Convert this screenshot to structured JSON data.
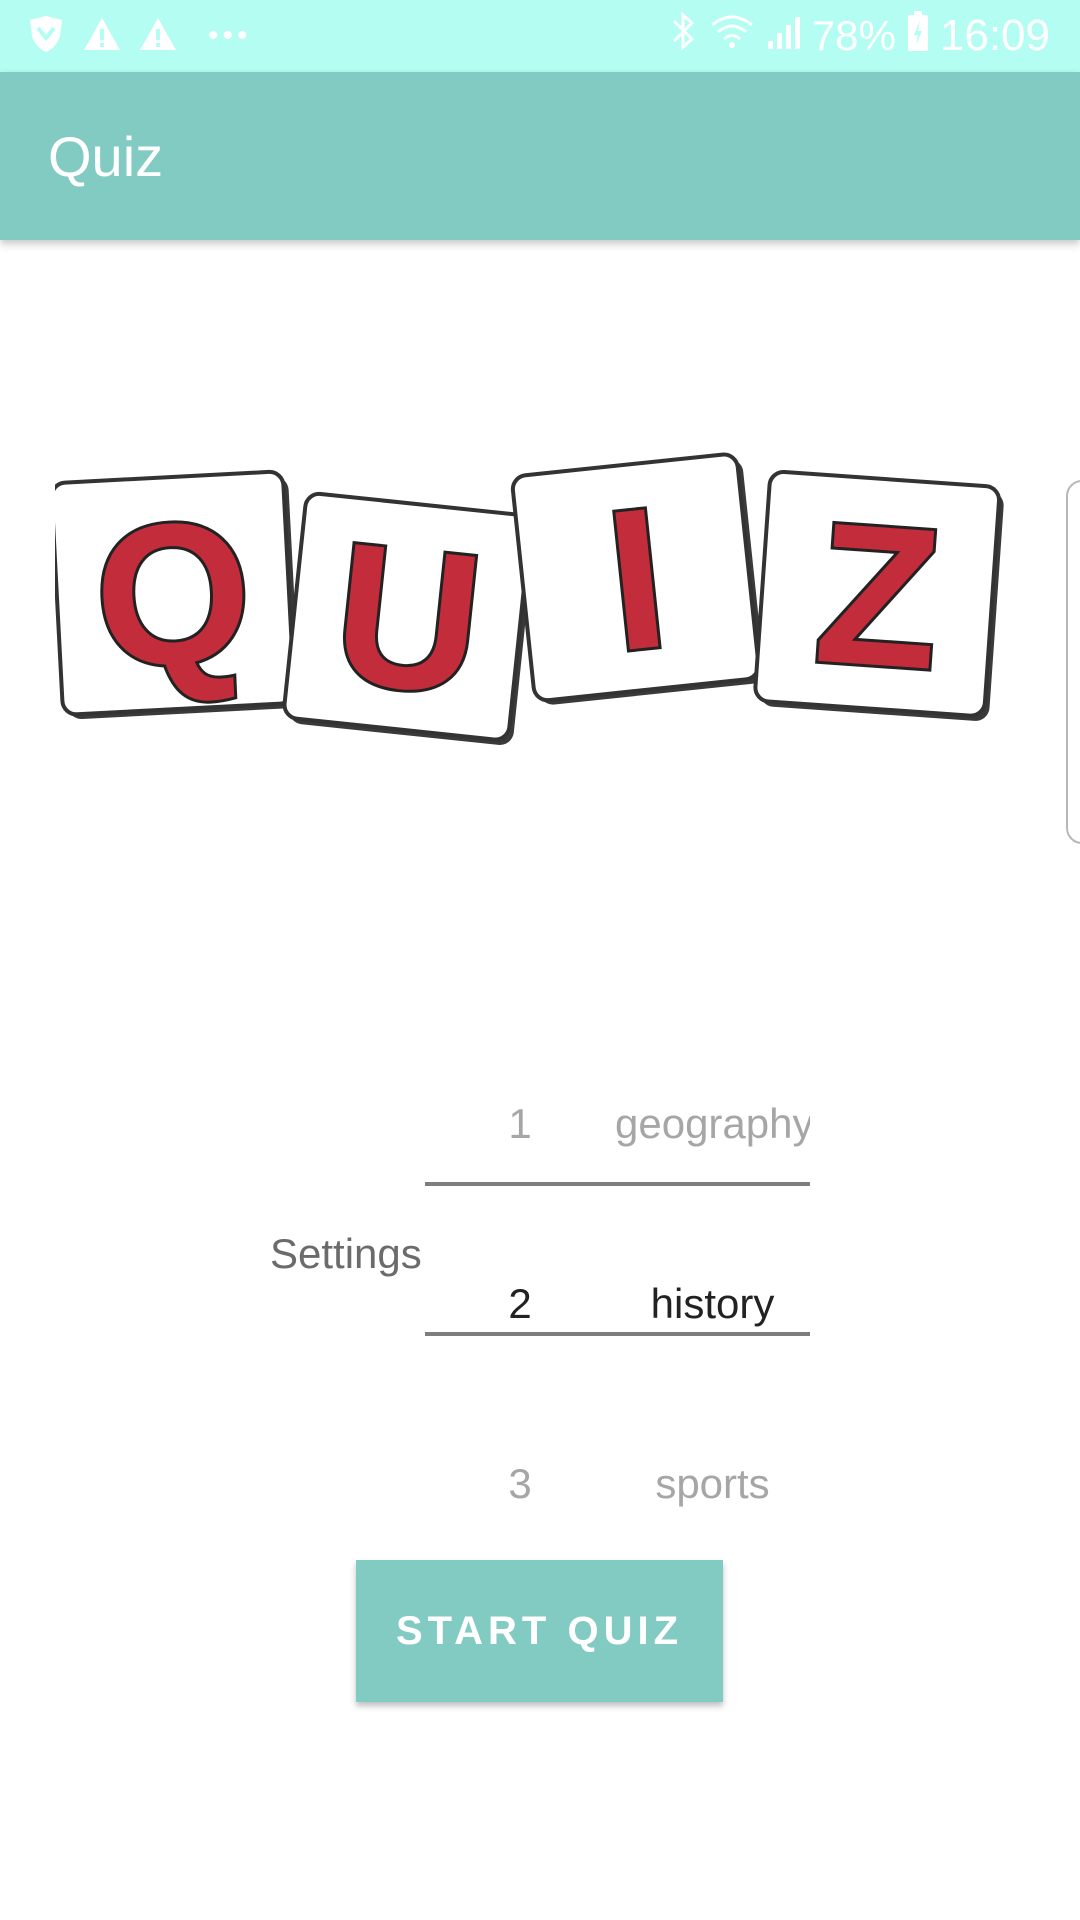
{
  "status_bar": {
    "battery_percent": "78%",
    "time": "16:09",
    "icons": [
      "shield-icon",
      "warning-icon",
      "warning-icon",
      "more-icon",
      "bluetooth-icon",
      "wifi-icon",
      "signal-icon",
      "battery-icon"
    ]
  },
  "app_bar": {
    "title": "Quiz"
  },
  "logo": {
    "letters": [
      "Q",
      "U",
      "I",
      "Z"
    ],
    "letter_color": "#c32c3b",
    "tile_color": "#ffffff"
  },
  "settings": {
    "label": "Settings",
    "picker": {
      "rows": [
        {
          "number": "1",
          "name": "geography"
        },
        {
          "number": "2",
          "name": "history"
        },
        {
          "number": "3",
          "name": "sports"
        }
      ],
      "selected_index": 1
    }
  },
  "start_button": {
    "label": "START QUIZ"
  },
  "colors": {
    "status_bar": "#b3fdf3",
    "accent": "#82cbc3"
  }
}
